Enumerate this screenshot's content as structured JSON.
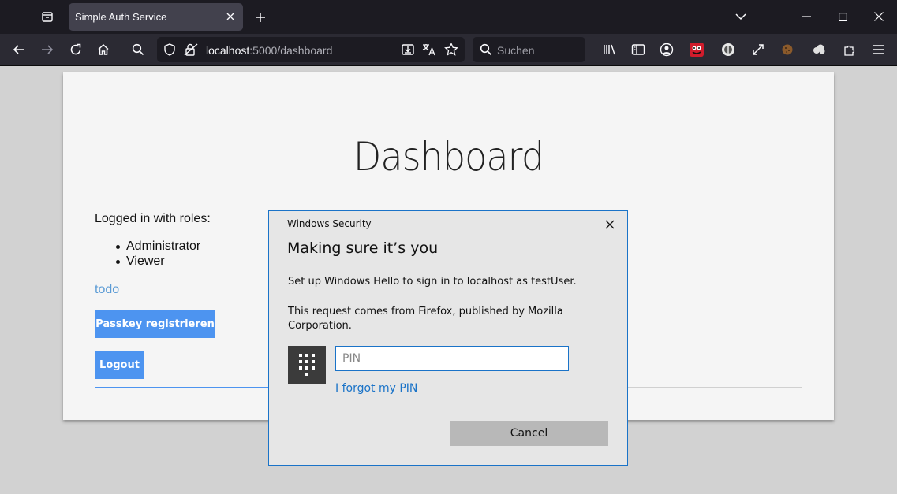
{
  "browser": {
    "tab_title": "Simple Auth Service",
    "url_host": "localhost",
    "url_rest": ":5000/dashboard",
    "search_placeholder": "Suchen"
  },
  "page": {
    "title": "Dashboard",
    "roles_label": "Logged in with roles:",
    "roles": [
      "Administrator",
      "Viewer"
    ],
    "todo_link": "todo",
    "passkey_button": "Passkey registrieren",
    "logout_button": "Logout"
  },
  "dialog": {
    "header": "Windows Security",
    "title": "Making sure it’s you",
    "message1": "Set up Windows Hello to sign in to localhost as testUser.",
    "message2": "This request comes from Firefox, published by Mozilla Corporation.",
    "pin_placeholder": "PIN",
    "forgot_link": "I forgot my PIN",
    "cancel_button": "Cancel"
  },
  "colors": {
    "accent": "#4d94f0",
    "dialog_border": "#1a73c8",
    "link": "#5b9bd5"
  }
}
